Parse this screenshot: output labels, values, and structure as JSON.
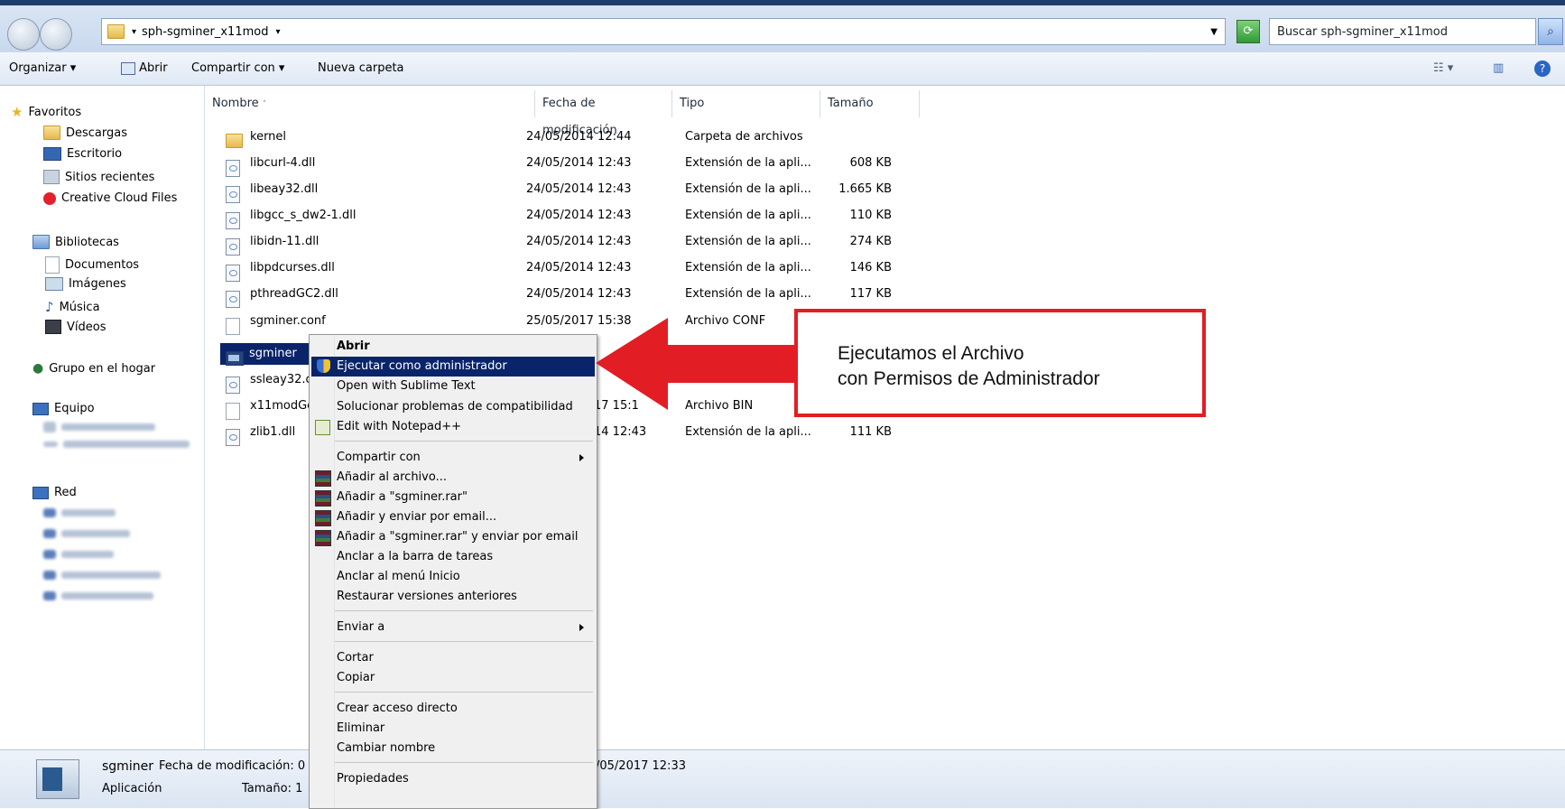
{
  "address": {
    "path": "sph-sgminer_x11mod",
    "search_placeholder": "Buscar sph-sgminer_x11mod"
  },
  "toolbar": {
    "organize": "Organizar",
    "open": "Abrir",
    "share": "Compartir con",
    "new_folder": "Nueva carpeta"
  },
  "nav": {
    "favorites_header": "Favoritos",
    "favorites": [
      "Descargas",
      "Escritorio",
      "Sitios recientes",
      "Creative Cloud Files"
    ],
    "libraries_header": "Bibliotecas",
    "libraries": [
      "Documentos",
      "Imágenes",
      "Música",
      "Vídeos"
    ],
    "homegroup": "Grupo en el hogar",
    "computer": "Equipo",
    "network": "Red"
  },
  "columns": {
    "name": "Nombre",
    "date": "Fecha de modificación",
    "type": "Tipo",
    "size": "Tamaño"
  },
  "files": [
    {
      "name": "kernel",
      "date": "24/05/2014 12:44",
      "type": "Carpeta de archivos",
      "size": "",
      "icon": "folder-icon"
    },
    {
      "name": "libcurl-4.dll",
      "date": "24/05/2014 12:43",
      "type": "Extensión de la apli...",
      "size": "608 KB",
      "icon": "dll-icon"
    },
    {
      "name": "libeay32.dll",
      "date": "24/05/2014 12:43",
      "type": "Extensión de la apli...",
      "size": "1.665 KB",
      "icon": "dll-icon"
    },
    {
      "name": "libgcc_s_dw2-1.dll",
      "date": "24/05/2014 12:43",
      "type": "Extensión de la apli...",
      "size": "110 KB",
      "icon": "dll-icon"
    },
    {
      "name": "libidn-11.dll",
      "date": "24/05/2014 12:43",
      "type": "Extensión de la apli...",
      "size": "274 KB",
      "icon": "dll-icon"
    },
    {
      "name": "libpdcurses.dll",
      "date": "24/05/2014 12:43",
      "type": "Extensión de la apli...",
      "size": "146 KB",
      "icon": "dll-icon"
    },
    {
      "name": "pthreadGC2.dll",
      "date": "24/05/2014 12:43",
      "type": "Extensión de la apli...",
      "size": "117 KB",
      "icon": "dll-icon"
    },
    {
      "name": "sgminer.conf",
      "date": "25/05/2017 15:38",
      "type": "Archivo CONF",
      "size": "",
      "icon": "file-icon"
    },
    {
      "name": "sgminer",
      "date": "",
      "type": "",
      "size": "",
      "icon": "exe-icon"
    },
    {
      "name": "ssleay32.c",
      "date": "",
      "type": "",
      "size": "",
      "icon": "dll-icon"
    },
    {
      "name": "x11modGe",
      "date": "17 15:1",
      "type": "Archivo BIN",
      "size": "",
      "icon": "file-icon"
    },
    {
      "name": "zlib1.dll",
      "date": "14 12:43",
      "type": "Extensión de la apli...",
      "size": "111 KB",
      "icon": "dll-icon"
    }
  ],
  "context_menu": [
    {
      "label": "Abrir",
      "bold": true
    },
    {
      "label": "Ejecutar como administrador",
      "highlight": true
    },
    {
      "label": "Open with Sublime Text"
    },
    {
      "label": "Solucionar problemas de compatibilidad"
    },
    {
      "label": "Edit with Notepad++"
    },
    {
      "label": "Compartir con",
      "submenu": true
    },
    {
      "label": "Añadir al archivo..."
    },
    {
      "label": "Añadir a \"sgminer.rar\""
    },
    {
      "label": "Añadir y enviar por email..."
    },
    {
      "label": "Añadir a \"sgminer.rar\" y enviar por email"
    },
    {
      "label": "Anclar a la barra de tareas"
    },
    {
      "label": "Anclar al menú Inicio"
    },
    {
      "label": "Restaurar versiones anteriores"
    },
    {
      "label": "Enviar a",
      "submenu": true
    },
    {
      "label": "Cortar"
    },
    {
      "label": "Copiar"
    },
    {
      "label": "Crear acceso directo"
    },
    {
      "label": "Eliminar"
    },
    {
      "label": "Cambiar nombre"
    },
    {
      "label": "Propiedades"
    }
  ],
  "details": {
    "name": "sgminer",
    "kind": "Aplicación",
    "modified_label": "Fecha de modificación: 0",
    "size_label": "Tamaño: 1",
    "date_fragment": "/05/2017 12:33"
  },
  "annotation": {
    "line1": "Ejecutamos el Archivo",
    "line2": "con Permisos de Administrador"
  },
  "colors": {
    "highlight": "#0a246a",
    "annotation_red": "#e21d24"
  }
}
